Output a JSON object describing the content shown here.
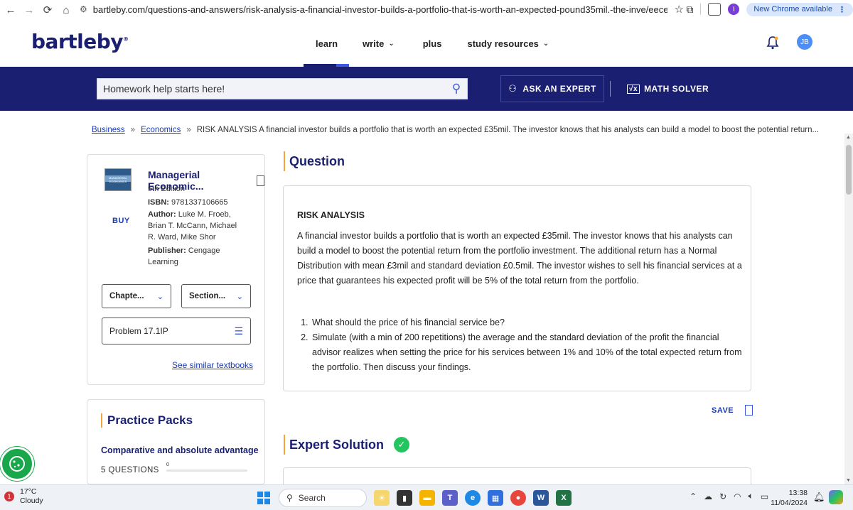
{
  "browser": {
    "url": "bartleby.com/questions-and-answers/risk-analysis-a-financial-investor-builds-a-portfolio-that-is-worth-an-expected-pound35mil.-the-inve/eeced5b0-c354-451...",
    "profile_initial": "I",
    "update_label": "New Chrome available"
  },
  "header": {
    "logo": "bartleby",
    "nav": [
      "learn",
      "write",
      "plus",
      "study resources"
    ],
    "avatar_initials": "JB"
  },
  "banner": {
    "search_placeholder": "Homework help starts here!",
    "ask_expert": "ASK AN EXPERT",
    "math_solver": "MATH SOLVER",
    "math_solver_badge": "√x"
  },
  "breadcrumb": {
    "items": [
      "Business",
      "Economics"
    ],
    "current": "RISK ANALYSIS A financial investor builds a portfolio that is worth an expected £35mil. The investor knows that his analysts can build a model to boost the potential return..."
  },
  "book": {
    "cover_text": "MANAGERIAL ECONOMICS",
    "title": "Managerial Economic...",
    "edition": "5th Edition",
    "isbn_label": "ISBN:",
    "isbn": "9781337106665",
    "author_label": "Author:",
    "author_line1": "Luke M. Froeb,",
    "author_line2": "Brian T. McCann, Michael",
    "author_line3": "R. Ward, Mike Shor",
    "publisher_label": "Publisher:",
    "publisher": "Cengage",
    "publisher_line2": "Learning",
    "buy": "BUY",
    "chapter_select": "Chapte...",
    "section_select": "Section...",
    "problem": "Problem 17.1IP",
    "similar_link": "See similar textbooks"
  },
  "practice": {
    "title": "Practice Packs",
    "topic": "Comparative and absolute advantage",
    "count": "5 QUESTIONS",
    "progress_value": "0",
    "progress_fraction": 0
  },
  "question": {
    "heading": "Question",
    "subtitle": "RISK ANALYSIS",
    "body": "A financial investor builds a portfolio that is worth an expected £35mil. The investor knows that his analysts can build a model to boost the potential return from the portfolio investment. The additional return has a Normal Distribution with mean £3mil and standard deviation £0.5mil. The investor wishes to sell his financial services at a price that guarantees his expected profit will be 5% of the total return from the portfolio.",
    "items": [
      "What should the price of his financial service be?",
      "Simulate (with a min of 200 repetitions) the average and the standard deviation of the profit the financial advisor realizes when setting the price for his services between 1% and 10% of the total expected return from the portfolio. Then discuss your findings."
    ],
    "save": "SAVE"
  },
  "expert": {
    "heading": "Expert Solution"
  },
  "taskbar": {
    "weather_alert": "1",
    "temperature": "17°C",
    "condition": "Cloudy",
    "search_label": "Search",
    "time": "13:38",
    "date": "11/04/2024"
  },
  "colors": {
    "brand_navy": "#1a1f71",
    "accent_blue": "#3c5adb",
    "heading_bar": "#f4a63b",
    "check_green": "#22c55e",
    "cookie_green": "#1aa64b"
  }
}
